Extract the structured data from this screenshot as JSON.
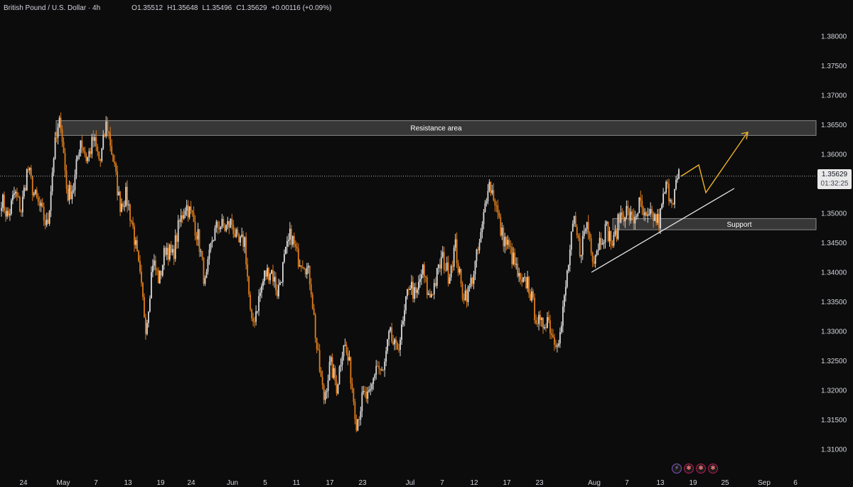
{
  "legend": {
    "symbol": "British Pound / U.S. Dollar · 4h",
    "open": "O1.35512",
    "high": "H1.35648",
    "low": "L1.35496",
    "close": "C1.35629",
    "change": "+0.00116 (+0.09%)"
  },
  "price_label": {
    "price": "1.35629",
    "countdown": "01:32:25"
  },
  "events": {
    "items": [
      {
        "icon": "lightning-icon",
        "glyph": "⚡"
      },
      {
        "icon": "uk-flag-icon",
        "glyph": "✱"
      },
      {
        "icon": "uk-flag-icon",
        "glyph": "✱"
      },
      {
        "icon": "uk-flag-icon",
        "glyph": "✱"
      }
    ]
  },
  "colors": {
    "background": "#0c0c0c",
    "up_candle": "#d9d9d9",
    "down_candle": "#e07c1a",
    "trendline": "#e6e6e6",
    "projection": "#f0b429",
    "zone_fill": "#3f3f3f"
  },
  "chart_data": {
    "type": "candlestick",
    "title": "British Pound / U.S. Dollar · 4h",
    "ylim": [
      1.306,
      1.3835
    ],
    "y_ticks": [
      "1.31000",
      "1.31500",
      "1.32000",
      "1.32500",
      "1.33000",
      "1.33500",
      "1.34000",
      "1.34500",
      "1.35000",
      "1.35500",
      "1.36000",
      "1.36500",
      "1.37000",
      "1.37500",
      "1.38000"
    ],
    "x_ticks": [
      "24",
      "May",
      "7",
      "13",
      "19",
      "24",
      "Jun",
      "5",
      "11",
      "17",
      "23",
      "Jul",
      "7",
      "12",
      "17",
      "23",
      "Aug",
      "7",
      "13",
      "19",
      "25",
      "Sep",
      "6"
    ],
    "last_price": 1.35629,
    "path": [
      [
        1.3525,
        1.354,
        1.3508
      ],
      [
        1.3492,
        1.3508,
        1.3476
      ],
      [
        1.3535,
        1.3552,
        1.352
      ],
      [
        1.3505,
        1.352,
        1.349
      ],
      [
        1.3578,
        1.3595,
        1.356
      ],
      [
        1.353,
        1.3545,
        1.3515
      ],
      [
        1.3505,
        1.352,
        1.349
      ],
      [
        1.3475,
        1.349,
        1.3458
      ],
      [
        1.3605,
        1.362,
        1.359
      ],
      [
        1.366,
        1.3665,
        1.3648
      ],
      [
        1.353,
        1.3545,
        1.3515
      ],
      [
        1.3545,
        1.356,
        1.353
      ],
      [
        1.3628,
        1.3645,
        1.361
      ],
      [
        1.359,
        1.3605,
        1.3575
      ],
      [
        1.3625,
        1.364,
        1.361
      ],
      [
        1.3585,
        1.36,
        1.357
      ],
      [
        1.3655,
        1.367,
        1.364
      ],
      [
        1.359,
        1.3605,
        1.3575
      ],
      [
        1.3515,
        1.353,
        1.35
      ],
      [
        1.353,
        1.3545,
        1.3515
      ],
      [
        1.3475,
        1.349,
        1.346
      ],
      [
        1.3395,
        1.341,
        1.338
      ],
      [
        1.3305,
        1.332,
        1.329
      ],
      [
        1.342,
        1.3435,
        1.3405
      ],
      [
        1.3385,
        1.34,
        1.337
      ],
      [
        1.3445,
        1.346,
        1.343
      ],
      [
        1.3425,
        1.344,
        1.341
      ],
      [
        1.348,
        1.3495,
        1.3465
      ],
      [
        1.3515,
        1.353,
        1.35
      ],
      [
        1.3495,
        1.351,
        1.348
      ],
      [
        1.3455,
        1.347,
        1.344
      ],
      [
        1.3375,
        1.339,
        1.336
      ],
      [
        1.3455,
        1.347,
        1.344
      ],
      [
        1.3482,
        1.3497,
        1.3467
      ],
      [
        1.3475,
        1.349,
        1.346
      ],
      [
        1.3485,
        1.35,
        1.347
      ],
      [
        1.3445,
        1.346,
        1.343
      ],
      [
        1.3455,
        1.347,
        1.344
      ],
      [
        1.3305,
        1.332,
        1.329
      ],
      [
        1.3348,
        1.3363,
        1.3333
      ],
      [
        1.3395,
        1.341,
        1.338
      ],
      [
        1.3405,
        1.342,
        1.339
      ],
      [
        1.3365,
        1.338,
        1.335
      ],
      [
        1.342,
        1.3435,
        1.3405
      ],
      [
        1.3465,
        1.348,
        1.345
      ],
      [
        1.3425,
        1.344,
        1.341
      ],
      [
        1.342,
        1.3435,
        1.3405
      ],
      [
        1.3385,
        1.34,
        1.337
      ],
      [
        1.3265,
        1.328,
        1.325
      ],
      [
        1.3185,
        1.32,
        1.317
      ],
      [
        1.3245,
        1.326,
        1.323
      ],
      [
        1.3205,
        1.322,
        1.319
      ],
      [
        1.3285,
        1.33,
        1.327
      ],
      [
        1.3235,
        1.325,
        1.322
      ],
      [
        1.3145,
        1.316,
        1.313
      ],
      [
        1.319,
        1.3205,
        1.3175
      ],
      [
        1.3185,
        1.32,
        1.317
      ],
      [
        1.3245,
        1.326,
        1.323
      ],
      [
        1.3225,
        1.324,
        1.321
      ],
      [
        1.3295,
        1.331,
        1.328
      ],
      [
        1.3265,
        1.328,
        1.325
      ],
      [
        1.3305,
        1.332,
        1.329
      ],
      [
        1.3385,
        1.34,
        1.337
      ],
      [
        1.3355,
        1.337,
        1.334
      ],
      [
        1.3405,
        1.342,
        1.339
      ],
      [
        1.3355,
        1.337,
        1.334
      ],
      [
        1.3385,
        1.34,
        1.337
      ],
      [
        1.3425,
        1.344,
        1.341
      ],
      [
        1.3395,
        1.341,
        1.338
      ],
      [
        1.3445,
        1.346,
        1.343
      ],
      [
        1.3365,
        1.338,
        1.335
      ],
      [
        1.3365,
        1.338,
        1.335
      ],
      [
        1.341,
        1.3425,
        1.3395
      ],
      [
        1.3465,
        1.348,
        1.345
      ],
      [
        1.3555,
        1.357,
        1.354
      ],
      [
        1.3525,
        1.354,
        1.351
      ],
      [
        1.3465,
        1.348,
        1.345
      ],
      [
        1.3445,
        1.346,
        1.343
      ],
      [
        1.3415,
        1.343,
        1.34
      ],
      [
        1.3375,
        1.339,
        1.336
      ],
      [
        1.3385,
        1.34,
        1.337
      ],
      [
        1.3335,
        1.335,
        1.332
      ],
      [
        1.3305,
        1.332,
        1.329
      ],
      [
        1.3325,
        1.334,
        1.331
      ],
      [
        1.3285,
        1.33,
        1.327
      ],
      [
        1.3295,
        1.331,
        1.328
      ],
      [
        1.3395,
        1.341,
        1.338
      ],
      [
        1.3485,
        1.35,
        1.347
      ],
      [
        1.3435,
        1.345,
        1.342
      ],
      [
        1.3485,
        1.35,
        1.347
      ],
      [
        1.3425,
        1.344,
        1.341
      ],
      [
        1.3455,
        1.347,
        1.344
      ],
      [
        1.3475,
        1.349,
        1.346
      ],
      [
        1.3445,
        1.346,
        1.343
      ],
      [
        1.3495,
        1.351,
        1.348
      ],
      [
        1.3505,
        1.352,
        1.349
      ],
      [
        1.3485,
        1.35,
        1.347
      ],
      [
        1.3515,
        1.353,
        1.35
      ],
      [
        1.3485,
        1.35,
        1.347
      ],
      [
        1.3495,
        1.351,
        1.348
      ],
      [
        1.3485,
        1.35,
        1.347
      ],
      [
        1.3545,
        1.356,
        1.353
      ],
      [
        1.3525,
        1.354,
        1.351
      ],
      [
        1.35629,
        1.35648,
        1.35496
      ]
    ]
  },
  "annotations": {
    "resistance": {
      "label": "Resistance area",
      "low": 1.3632,
      "high": 1.3657
    },
    "support": {
      "label": "Support",
      "low": 1.3472,
      "high": 1.3491
    }
  }
}
